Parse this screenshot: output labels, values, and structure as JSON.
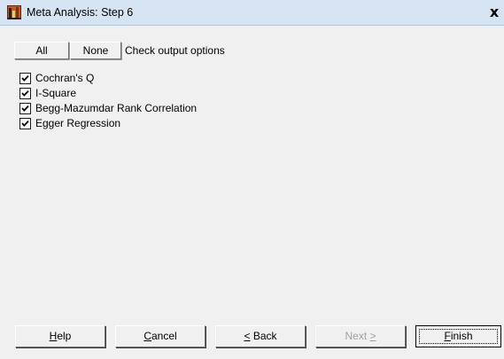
{
  "window": {
    "title": "Meta Analysis: Step 6",
    "close_label": "x"
  },
  "toolbar": {
    "all_label": "All",
    "none_label": "None",
    "check_output_label": "Check output options"
  },
  "options": [
    {
      "label": "Cochran's Q",
      "checked": true
    },
    {
      "label": "I-Square",
      "checked": true
    },
    {
      "label": "Begg-Mazumdar Rank Correlation",
      "checked": true
    },
    {
      "label": "Egger Regression",
      "checked": true
    }
  ],
  "buttons": {
    "help": {
      "accel": "H",
      "rest": "elp"
    },
    "cancel": {
      "accel": "C",
      "rest": "ancel"
    },
    "back": {
      "accel": "<",
      "rest": " Back"
    },
    "next": {
      "pre": "Next ",
      "accel": ">"
    },
    "finish": {
      "accel": "F",
      "rest": "inish"
    }
  },
  "colors": {
    "titlebar": "#d6e3f2",
    "panel": "#f0f0f0",
    "disabled_text": "#a0a0a0"
  },
  "icons": {
    "app": "meta-analysis-app-icon",
    "checkbox": "checkmark-icon"
  }
}
